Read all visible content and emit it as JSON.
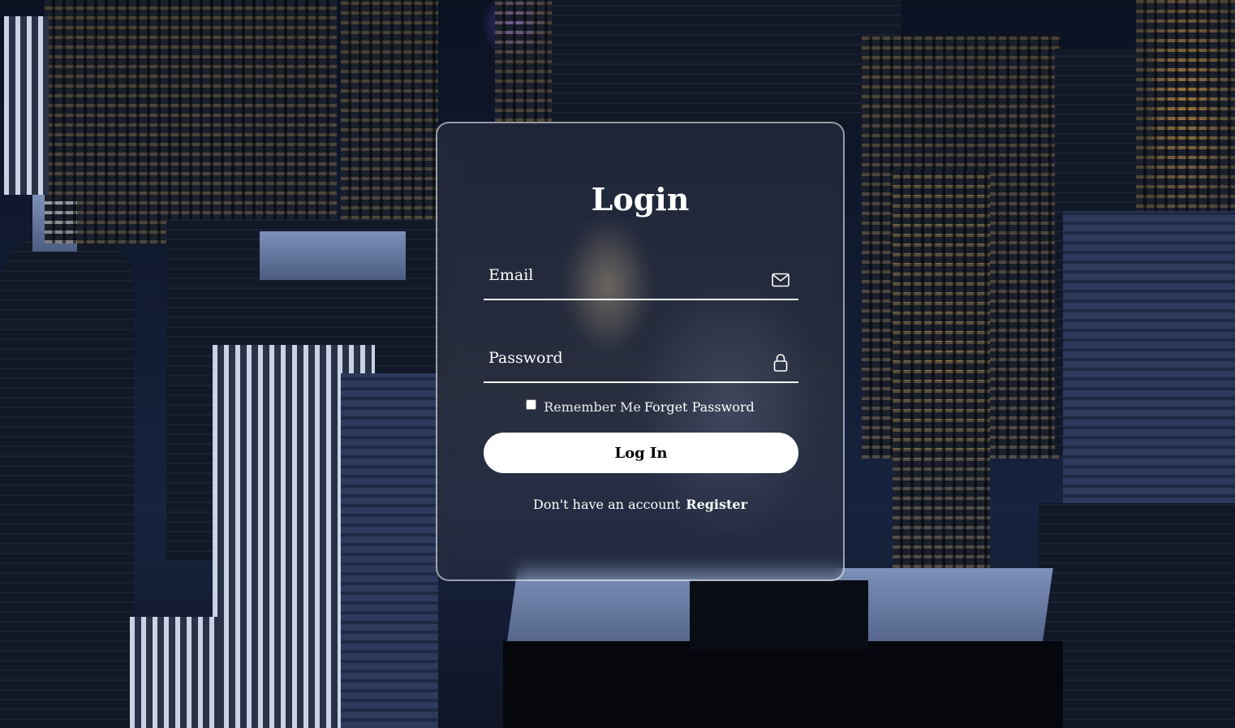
{
  "login": {
    "title": "Login",
    "email_placeholder": "Email",
    "password_placeholder": "Password",
    "remember_label": "Remember Me",
    "forget_link": "Forget Password",
    "submit_label": "Log In",
    "register_prompt": "Don't have an account",
    "register_link": "Register",
    "icons": {
      "email": "envelope-icon",
      "password": "lock-icon"
    }
  },
  "colors": {
    "text": "#ffffff",
    "button_bg": "#ffffff",
    "button_text": "#000000",
    "card_border": "rgba(255,255,255,0.55)"
  }
}
